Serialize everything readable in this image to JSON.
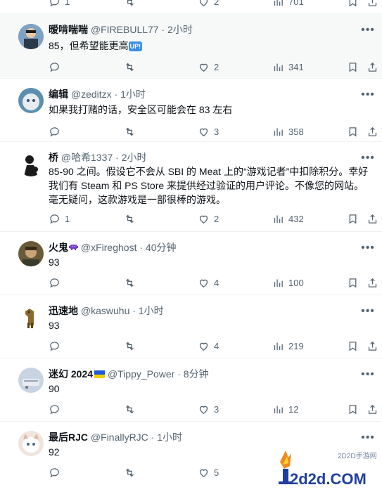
{
  "top_row": {
    "reply": "1",
    "like": "2",
    "views": "701"
  },
  "tweets": [
    {
      "name": "暧啃喘喘",
      "handle": "@FIREBULL77",
      "time": "· 2小时",
      "text": "85，但希望能更高",
      "badge": "UP!",
      "reply": "",
      "like": "2",
      "views": "341"
    },
    {
      "name": "编辑",
      "handle": "@zeditzx",
      "time": "· 1小时",
      "text": "如果我打赌的话，安全区可能会在 83 左右",
      "reply": "",
      "like": "3",
      "views": "358"
    },
    {
      "name": "桥",
      "handle": "@哈希1337",
      "time": "· 2小时",
      "text": "85-90 之间。假设它不会从 SBI 的 Meat 上的“游戏记者”中扣除积分。幸好我们有 Steam 和 PS Store 来提供经过验证的用户评论。不像您的网站。毫无疑问，这款游戏是一部很棒的游戏。",
      "reply": "1",
      "like": "2",
      "views": "432"
    },
    {
      "name": "火鬼",
      "handle": "@xFireghost",
      "time": "· 40分钟",
      "text": "93",
      "reply": "",
      "like": "4",
      "views": "100"
    },
    {
      "name": "迅速地",
      "handle": "@kaswuhu",
      "time": "· 1小时",
      "text": "93",
      "reply": "",
      "like": "4",
      "views": "219"
    },
    {
      "name": "迷幻 2024",
      "handle": "@Tippy_Power",
      "time": "· 8分钟",
      "text": "90",
      "reply": "",
      "like": "3",
      "views": "12"
    },
    {
      "name": "最后RJC",
      "handle": "@FinallyRJC",
      "time": "· 1小时",
      "text": "92",
      "reply": "",
      "like": "5",
      "views": ""
    }
  ],
  "watermark": {
    "top": "2D2D手游网",
    "main": "2d2d.COM"
  },
  "colors": {
    "text": "#0f1419",
    "muted": "#536471",
    "border": "#eff3f4",
    "highlight": "#f7f9f9",
    "watermark": "#1f3fa0"
  }
}
